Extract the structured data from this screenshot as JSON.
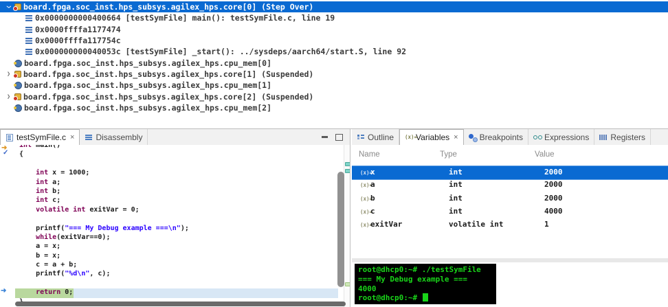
{
  "colors": {
    "selection_blue": "#0a6ad2",
    "keyword": "#7f0055",
    "string": "#2a00ff",
    "current_line_green": "#b9d89e",
    "current_line_blue": "#d8e7f5",
    "terminal_green": "#19d419"
  },
  "debug_tree": {
    "rows": [
      {
        "kind": "thread",
        "chevron": "expanded",
        "selected": true,
        "icon": "core-icon",
        "label": "board.fpga.soc_inst.hps_subsys.agilex_hps.core[0] (Step Over)"
      },
      {
        "kind": "frame",
        "icon": "stack-frame-icon",
        "label": "0x0000000000400664 [testSymFile] main(): testSymFile.c, line 19"
      },
      {
        "kind": "frame",
        "icon": "stack-frame-icon",
        "label": "0x0000ffffa1177474"
      },
      {
        "kind": "frame",
        "icon": "stack-frame-icon",
        "label": "0x0000ffffa117754c"
      },
      {
        "kind": "frame",
        "icon": "stack-frame-icon",
        "label": "0x000000000040053c [testSymFile] _start(): ../sysdeps/aarch64/start.S, line 92"
      },
      {
        "kind": "mem",
        "icon": "memory-icon",
        "label": "board.fpga.soc_inst.hps_subsys.agilex_hps.cpu_mem[0]"
      },
      {
        "kind": "thread",
        "chevron": "collapsed",
        "icon": "core-icon",
        "label": "board.fpga.soc_inst.hps_subsys.agilex_hps.core[1] (Suspended)"
      },
      {
        "kind": "mem",
        "icon": "memory-icon",
        "label": "board.fpga.soc_inst.hps_subsys.agilex_hps.cpu_mem[1]"
      },
      {
        "kind": "thread",
        "chevron": "collapsed",
        "icon": "core-icon",
        "label": "board.fpga.soc_inst.hps_subsys.agilex_hps.core[2] (Suspended)"
      },
      {
        "kind": "mem",
        "icon": "memory-icon",
        "label": "board.fpga.soc_inst.hps_subsys.agilex_hps.cpu_mem[2]"
      }
    ]
  },
  "editor": {
    "tabs": [
      {
        "label": "testSymFile.c",
        "icon": "c-file-icon",
        "active": true,
        "close": "×"
      },
      {
        "label": "Disassembly",
        "icon": "disassembly-icon"
      }
    ],
    "code_lines": [
      {
        "tokens": [
          {
            "t": "kw",
            "s": "int"
          },
          {
            "t": "pl",
            "s": " main()"
          }
        ]
      },
      {
        "tokens": [
          {
            "t": "pl",
            "s": "{"
          }
        ]
      },
      {
        "tokens": []
      },
      {
        "tokens": [
          {
            "t": "pl",
            "s": "    "
          },
          {
            "t": "kw",
            "s": "int"
          },
          {
            "t": "pl",
            "s": " x = 1000;"
          }
        ]
      },
      {
        "tokens": [
          {
            "t": "pl",
            "s": "    "
          },
          {
            "t": "kw",
            "s": "int"
          },
          {
            "t": "pl",
            "s": " a;"
          }
        ]
      },
      {
        "tokens": [
          {
            "t": "pl",
            "s": "    "
          },
          {
            "t": "kw",
            "s": "int"
          },
          {
            "t": "pl",
            "s": " b;"
          }
        ]
      },
      {
        "tokens": [
          {
            "t": "pl",
            "s": "    "
          },
          {
            "t": "kw",
            "s": "int"
          },
          {
            "t": "pl",
            "s": " c;"
          }
        ]
      },
      {
        "tokens": [
          {
            "t": "pl",
            "s": "    "
          },
          {
            "t": "kw",
            "s": "volatile"
          },
          {
            "t": "pl",
            "s": " "
          },
          {
            "t": "kw",
            "s": "int"
          },
          {
            "t": "pl",
            "s": " exitVar = 0;"
          }
        ]
      },
      {
        "tokens": []
      },
      {
        "tokens": [
          {
            "t": "pl",
            "s": "    printf("
          },
          {
            "t": "str",
            "s": "\"=== My Debug example ===\\n\""
          },
          {
            "t": "pl",
            "s": ");"
          }
        ]
      },
      {
        "tokens": [
          {
            "t": "pl",
            "s": "    "
          },
          {
            "t": "kw",
            "s": "while"
          },
          {
            "t": "pl",
            "s": "(exitVar==0);"
          }
        ]
      },
      {
        "tokens": [
          {
            "t": "pl",
            "s": "    a = x;"
          }
        ]
      },
      {
        "tokens": [
          {
            "t": "pl",
            "s": "    b = x;"
          }
        ]
      },
      {
        "tokens": [
          {
            "t": "pl",
            "s": "    c = a + b;"
          }
        ]
      },
      {
        "tokens": [
          {
            "t": "pl",
            "s": "    printf("
          },
          {
            "t": "str",
            "s": "\"%d\\n\""
          },
          {
            "t": "pl",
            "s": ", c);"
          }
        ]
      },
      {
        "tokens": []
      },
      {
        "current": true,
        "tokens": [
          {
            "t": "pl",
            "s": "    "
          },
          {
            "t": "kw",
            "s": "return"
          },
          {
            "t": "pl",
            "s": " 0;"
          }
        ]
      },
      {
        "tokens": [
          {
            "t": "pl",
            "s": "}"
          }
        ]
      }
    ]
  },
  "right_panel": {
    "tabs": [
      {
        "label": "Outline",
        "icon": "outline-icon"
      },
      {
        "label": "Variables",
        "icon": "variables-icon",
        "active": true,
        "close": "×"
      },
      {
        "label": "Breakpoints",
        "icon": "breakpoints-icon"
      },
      {
        "label": "Expressions",
        "icon": "expressions-icon"
      },
      {
        "label": "Registers",
        "icon": "registers-icon"
      }
    ],
    "variables": {
      "columns": [
        "Name",
        "Type",
        "Value"
      ],
      "rows": [
        {
          "name": "x",
          "type": "int",
          "value": "2000",
          "selected": true
        },
        {
          "name": "a",
          "type": "int",
          "value": "2000"
        },
        {
          "name": "b",
          "type": "int",
          "value": "2000"
        },
        {
          "name": "c",
          "type": "int",
          "value": "4000"
        },
        {
          "name": "exitVar",
          "type": "volatile int",
          "value": "1"
        }
      ]
    }
  },
  "terminal": {
    "lines": [
      {
        "text": "root@dhcp0:~# ./testSymFile"
      },
      {
        "text": "=== My Debug example ==="
      },
      {
        "text": "4000"
      },
      {
        "text": "root@dhcp0:~# ",
        "cursor": true
      }
    ]
  }
}
